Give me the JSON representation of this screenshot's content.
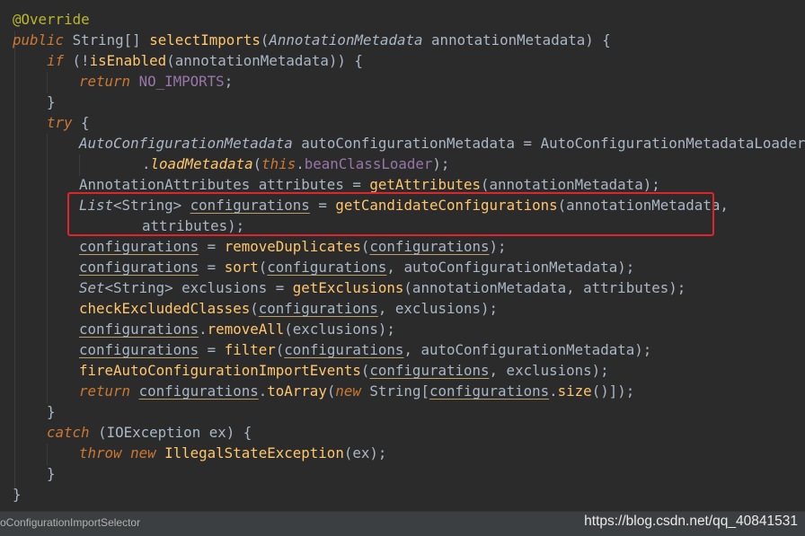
{
  "code_lines": [
    {
      "tokens": [
        {
          "t": "@Override",
          "c": "ann"
        }
      ]
    },
    {
      "tokens": [
        {
          "t": "public ",
          "c": "kw"
        },
        {
          "t": "String[] ",
          "c": ""
        },
        {
          "t": "selectImports",
          "c": "fn"
        },
        {
          "t": "(",
          "c": ""
        },
        {
          "t": "AnnotationMetadata ",
          "c": "ital"
        },
        {
          "t": "annotationMetadata) {",
          "c": ""
        }
      ]
    },
    {
      "tokens": [
        {
          "t": "if ",
          "c": "kw"
        },
        {
          "t": "(!",
          "c": ""
        },
        {
          "t": "isEnabled",
          "c": "fn"
        },
        {
          "t": "(annotationMetadata)) {",
          "c": ""
        }
      ]
    },
    {
      "tokens": [
        {
          "t": "return ",
          "c": "kw"
        },
        {
          "t": "NO_IMPORTS",
          "c": "fld"
        },
        {
          "t": ";",
          "c": ""
        }
      ]
    },
    {
      "tokens": [
        {
          "t": "}",
          "c": ""
        }
      ]
    },
    {
      "tokens": [
        {
          "t": "try ",
          "c": "kw"
        },
        {
          "t": "{",
          "c": ""
        }
      ]
    },
    {
      "tokens": [
        {
          "t": "AutoConfigurationMetadata ",
          "c": "ital"
        },
        {
          "t": "autoConfigurationMetadata = AutoConfigurationMetadataLoader",
          "c": ""
        }
      ]
    },
    {
      "tokens": [
        {
          "t": ".",
          "c": ""
        },
        {
          "t": "loadMetadata",
          "c": "fn ital"
        },
        {
          "t": "(",
          "c": ""
        },
        {
          "t": "this",
          "c": "kw"
        },
        {
          "t": ".",
          "c": ""
        },
        {
          "t": "beanClassLoader",
          "c": "fld"
        },
        {
          "t": ");",
          "c": ""
        }
      ]
    },
    {
      "tokens": [
        {
          "t": "AnnotationAttributes attributes = ",
          "c": ""
        },
        {
          "t": "getAttributes",
          "c": "fn"
        },
        {
          "t": "(annotationMetadata);",
          "c": ""
        }
      ]
    },
    {
      "tokens": [
        {
          "t": "List",
          "c": "ital"
        },
        {
          "t": "<String> ",
          "c": ""
        },
        {
          "t": "configurations",
          "c": "ul"
        },
        {
          "t": " = ",
          "c": ""
        },
        {
          "t": "getCandidateConfigurations",
          "c": "fn"
        },
        {
          "t": "(annotationMetadata,",
          "c": ""
        }
      ]
    },
    {
      "tokens": [
        {
          "t": "attributes);",
          "c": ""
        }
      ]
    },
    {
      "tokens": [
        {
          "t": "configurations",
          "c": "ul"
        },
        {
          "t": " = ",
          "c": ""
        },
        {
          "t": "removeDuplicates",
          "c": "fn"
        },
        {
          "t": "(",
          "c": ""
        },
        {
          "t": "configurations",
          "c": "ul"
        },
        {
          "t": ");",
          "c": ""
        }
      ]
    },
    {
      "tokens": [
        {
          "t": "configurations",
          "c": "ul"
        },
        {
          "t": " = ",
          "c": ""
        },
        {
          "t": "sort",
          "c": "fn"
        },
        {
          "t": "(",
          "c": ""
        },
        {
          "t": "configurations",
          "c": "ul"
        },
        {
          "t": ", autoConfigurationMetadata);",
          "c": ""
        }
      ]
    },
    {
      "tokens": [
        {
          "t": "Set",
          "c": "ital"
        },
        {
          "t": "<String> exclusions = ",
          "c": ""
        },
        {
          "t": "getExclusions",
          "c": "fn"
        },
        {
          "t": "(annotationMetadata, attributes);",
          "c": ""
        }
      ]
    },
    {
      "tokens": [
        {
          "t": "checkExcludedClasses",
          "c": "fn"
        },
        {
          "t": "(",
          "c": ""
        },
        {
          "t": "configurations",
          "c": "ul"
        },
        {
          "t": ", exclusions);",
          "c": ""
        }
      ]
    },
    {
      "tokens": [
        {
          "t": "configurations",
          "c": "ul"
        },
        {
          "t": ".",
          "c": ""
        },
        {
          "t": "removeAll",
          "c": "fn"
        },
        {
          "t": "(exclusions);",
          "c": ""
        }
      ]
    },
    {
      "tokens": [
        {
          "t": "configurations",
          "c": "ul"
        },
        {
          "t": " = ",
          "c": ""
        },
        {
          "t": "filter",
          "c": "fn"
        },
        {
          "t": "(",
          "c": ""
        },
        {
          "t": "configurations",
          "c": "ul"
        },
        {
          "t": ", autoConfigurationMetadata);",
          "c": ""
        }
      ]
    },
    {
      "tokens": [
        {
          "t": "fireAutoConfigurationImportEvents",
          "c": "fn"
        },
        {
          "t": "(",
          "c": ""
        },
        {
          "t": "configurations",
          "c": "ul"
        },
        {
          "t": ", exclusions);",
          "c": ""
        }
      ]
    },
    {
      "tokens": [
        {
          "t": "return ",
          "c": "kw"
        },
        {
          "t": "configurations",
          "c": "ul"
        },
        {
          "t": ".",
          "c": ""
        },
        {
          "t": "toArray",
          "c": "fn"
        },
        {
          "t": "(",
          "c": ""
        },
        {
          "t": "new ",
          "c": "kw"
        },
        {
          "t": "String[",
          "c": ""
        },
        {
          "t": "configurations",
          "c": "ul"
        },
        {
          "t": ".",
          "c": ""
        },
        {
          "t": "size",
          "c": "fn"
        },
        {
          "t": "()]);",
          "c": ""
        }
      ]
    },
    {
      "tokens": [
        {
          "t": "}",
          "c": ""
        }
      ]
    },
    {
      "tokens": [
        {
          "t": "catch ",
          "c": "kw"
        },
        {
          "t": "(IOException ex) {",
          "c": ""
        }
      ]
    },
    {
      "tokens": [
        {
          "t": "throw new ",
          "c": "kw"
        },
        {
          "t": "IllegalStateException",
          "c": "fn"
        },
        {
          "t": "(ex);",
          "c": ""
        }
      ]
    },
    {
      "tokens": [
        {
          "t": "}",
          "c": ""
        }
      ]
    },
    {
      "tokens": [
        {
          "t": "}",
          "c": ""
        }
      ]
    }
  ],
  "breadcrumb": "oConfigurationImportSelector",
  "watermark": "https://blog.csdn.net/qq_40841531",
  "colors": {
    "background": "#2b2b2b",
    "keyword": "#cc7832",
    "annotation": "#bbb529",
    "method": "#ffc66d",
    "field": "#9876aa",
    "text": "#a9b7c6",
    "highlight_border": "#e0242b"
  }
}
